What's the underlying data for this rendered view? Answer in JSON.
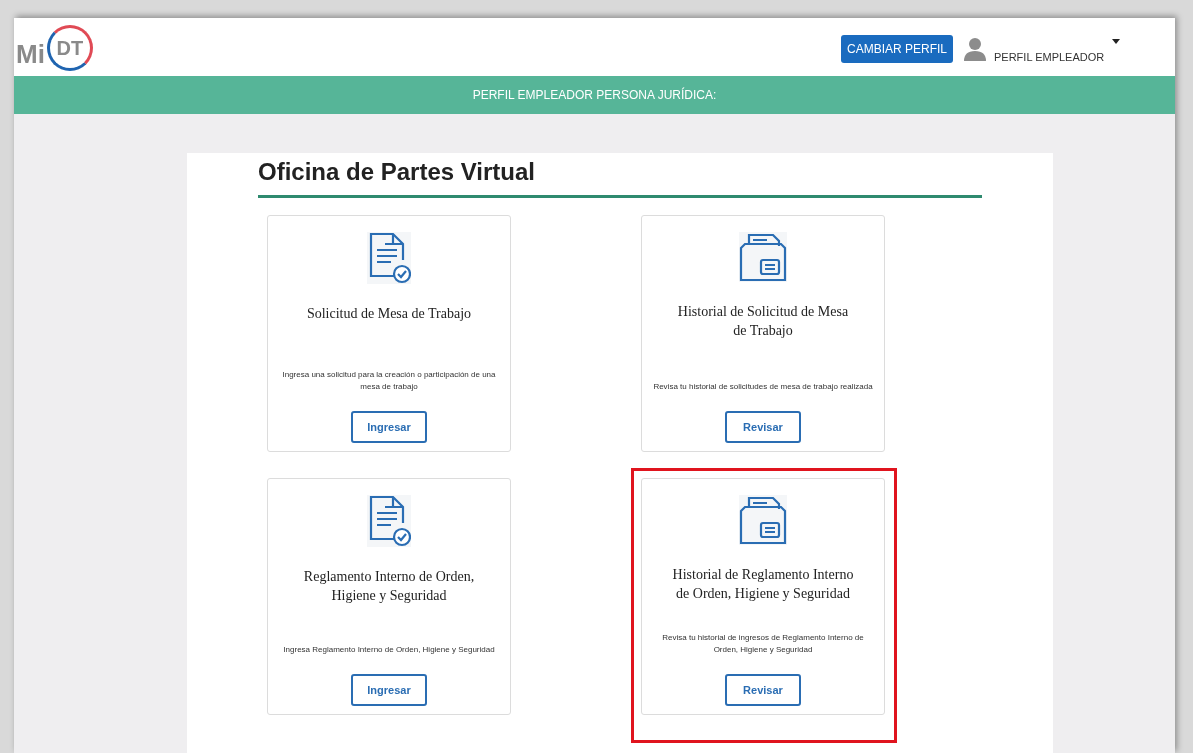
{
  "header": {
    "logo_text": "Mi",
    "logo_badge": "DT",
    "change_profile_button": "CAMBIAR PERFIL",
    "user_menu": "PERFIL EMPLEADOR"
  },
  "banner": "PERFIL EMPLEADOR PERSONA JURÍDICA:",
  "page_title": "Oficina de Partes Virtual",
  "cards": [
    {
      "kind": "document",
      "title": "Solicitud de Mesa de Trabajo",
      "description": "Ingresa una solicitud para la creación o participación de una mesa de trabajo",
      "button": "Ingresar",
      "highlighted": false
    },
    {
      "kind": "folder",
      "title": "Historial de Solicitud de Mesa de Trabajo",
      "description": "Revisa tu historial de solicitudes de mesa de trabajo realizada",
      "button": "Revisar",
      "highlighted": false
    },
    {
      "kind": "document",
      "title": "Reglamento Interno de Orden, Higiene y Seguridad",
      "description": "Ingresa Reglamento Interno de Orden, Higiene y Seguridad",
      "button": "Ingresar",
      "highlighted": false
    },
    {
      "kind": "folder",
      "title": "Historial de Reglamento Interno de Orden, Higiene y Seguridad",
      "description": "Revisa tu historial de ingresos de Reglamento Interno de Orden, Higiene y Seguridad",
      "button": "Revisar",
      "highlighted": true
    }
  ]
}
